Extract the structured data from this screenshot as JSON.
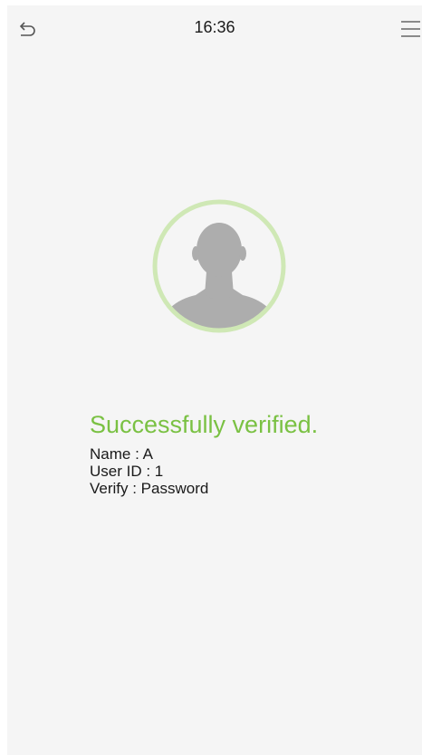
{
  "header": {
    "time": "16:36",
    "back_icon": "back-arrow-icon",
    "menu_icon": "hamburger-menu-icon"
  },
  "avatar": {
    "icon": "user-silhouette-icon",
    "ring_color": "#cfe8b5"
  },
  "result": {
    "status": "Successfully verified.",
    "status_color": "#7ac143",
    "name": "Name : A",
    "user_id": "User ID : 1",
    "verify": "Verify : Password"
  }
}
